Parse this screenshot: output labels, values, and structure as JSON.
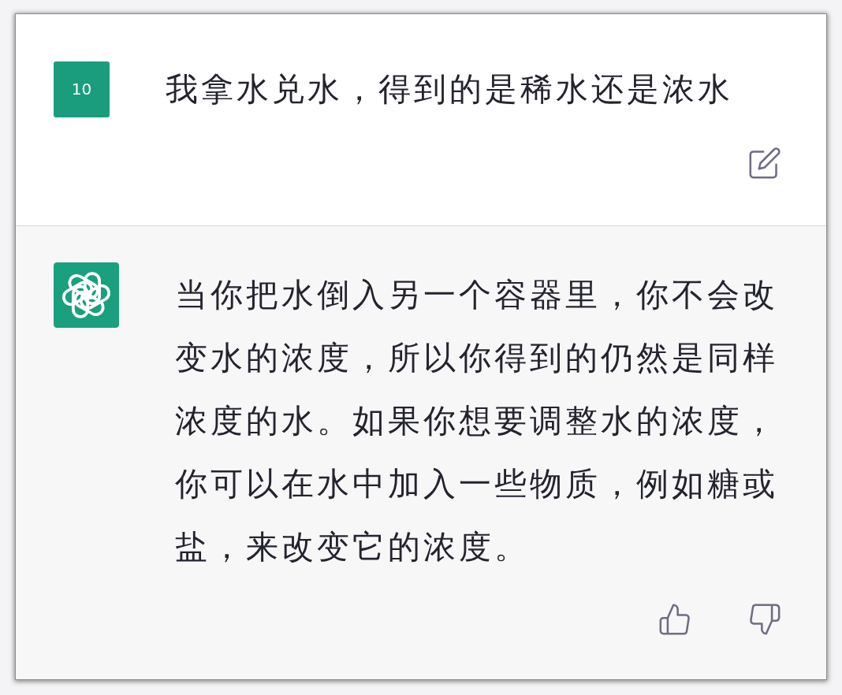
{
  "messages": [
    {
      "kind": "user",
      "avatar": "10",
      "text": "我拿水兑水，得到的是稀水还是浓水",
      "actions": [
        {
          "kind": "edit"
        }
      ]
    },
    {
      "kind": "assistant",
      "text": "当你把水倒入另一个容器里，你不会改变水的浓度，所以你得到的仍然是同样浓度的水。如果你想要调整水的浓度，你可以在水中加入一些物质，例如糖或盐，来改变它的浓度。",
      "actions": [
        {
          "kind": "thumbs_up"
        },
        {
          "kind": "thumbs_down"
        }
      ]
    }
  ]
}
